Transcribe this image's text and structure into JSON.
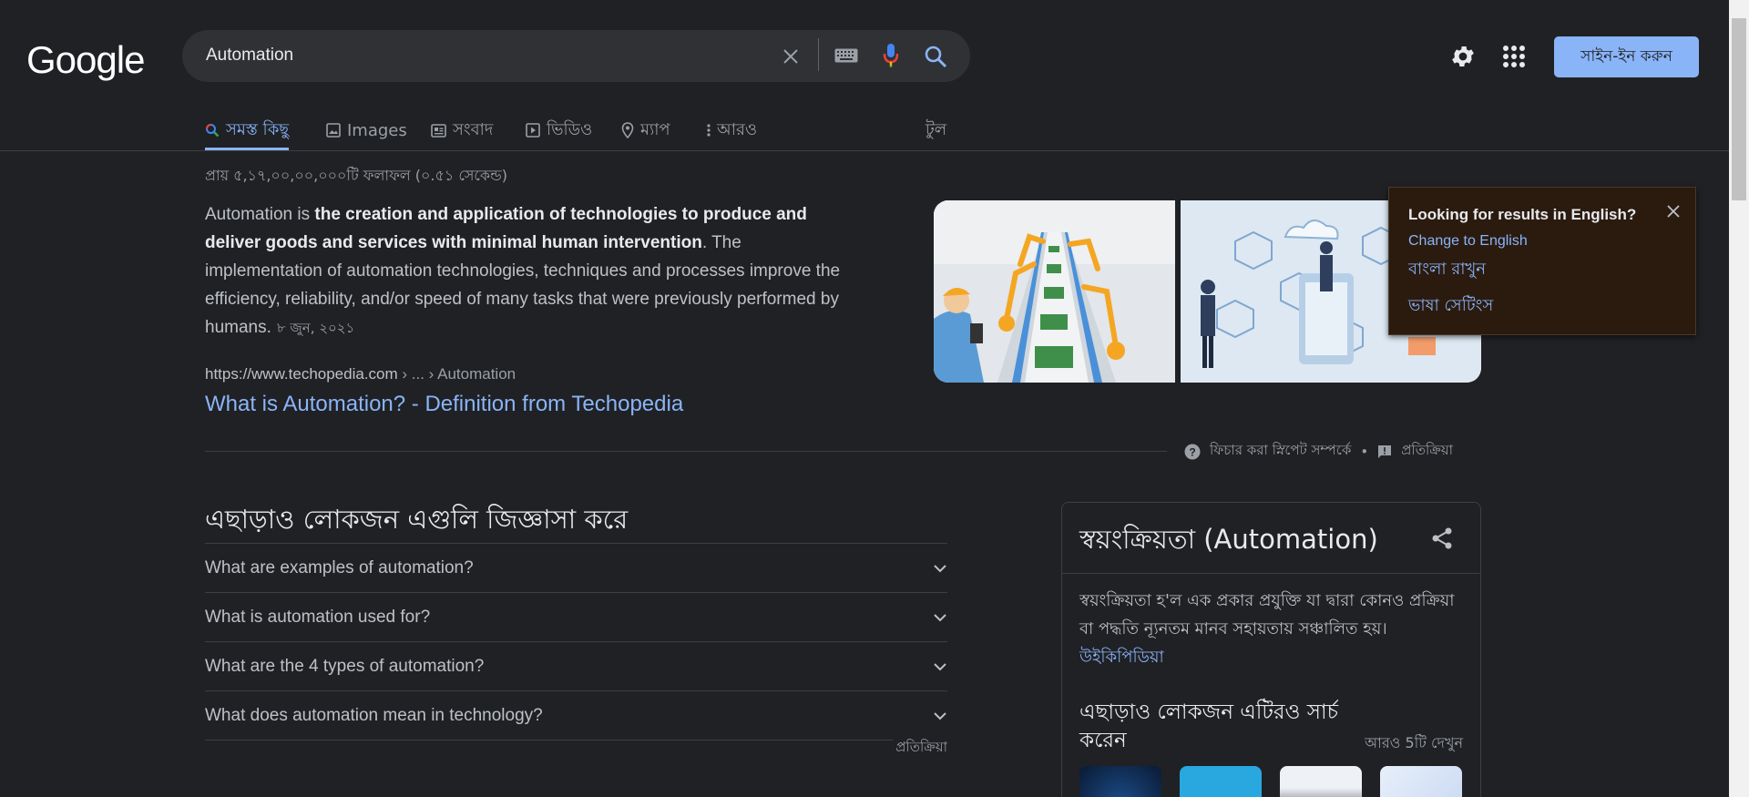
{
  "logo": "Google",
  "search": {
    "query": "Automation"
  },
  "header": {
    "signin_label": "সাইন-ইন করুন"
  },
  "tabs": [
    {
      "label": "সমস্ত কিছু",
      "icon": "search-icon",
      "active": true
    },
    {
      "label": "Images",
      "icon": "image-icon"
    },
    {
      "label": "সংবাদ",
      "icon": "news-icon"
    },
    {
      "label": "ভিডিও",
      "icon": "video-icon"
    },
    {
      "label": "ম্যাপ",
      "icon": "map-pin-icon"
    },
    {
      "label": "আরও",
      "icon": "more-vert-icon"
    }
  ],
  "tools_label": "টুল",
  "stats": "প্রায় ৫,১৭,০০,০০,০০০টি ফলাফল (০.৫১ সেকেন্ড)",
  "snippet": {
    "lead": "Automation is ",
    "bold": "the creation and application of technologies to produce and deliver goods and services with minimal human intervention",
    "rest": ". The implementation of automation technologies, techniques and processes improve the efficiency, reliability, and/or speed of many tasks that were previously performed by humans.",
    "date": "৮ জুন, ২০২১",
    "cite_domain": "https://www.techopedia.com",
    "cite_path": " › ... › Automation",
    "title": "What is Automation? - Definition from Techopedia",
    "footer_about": "ফিচার করা স্নিপেট সম্পর্কে",
    "footer_feedback": "প্রতিক্রিয়া"
  },
  "lang_popup": {
    "title": "Looking for results in English?",
    "change": "Change to English",
    "keep": "বাংলা রাখুন",
    "settings": "ভাষা সেটিংস"
  },
  "paa": {
    "heading": "এছাড়াও লোকজন এগুলি জিজ্ঞাসা করে",
    "questions": [
      "What are examples of automation?",
      "What is automation used for?",
      "What are the 4 types of automation?",
      "What does automation mean in technology?"
    ],
    "feedback": "প্রতিক্রিয়া"
  },
  "knowledge_panel": {
    "title": "স্বয়ংক্রিয়তা (Automation)",
    "description": "স্বয়ংক্রিয়তা হ'ল এক প্রকার প্রযুক্তি যা দ্বারা কোনও প্রক্রিয়া বা পদ্ধতি ন্যূনতম মানব সহায়তায় সঞ্চালিত হয়।",
    "source": "উইকিপিডিয়া",
    "also_searched": "এছাড়াও লোকজন এটিরও সার্চ করেন",
    "see_more": "আরও 5টি দেখুন"
  },
  "colors": {
    "background": "#202124",
    "link": "#8ab4f8",
    "text": "#bdc1c6",
    "popup_bg": "#2b1b0f"
  }
}
